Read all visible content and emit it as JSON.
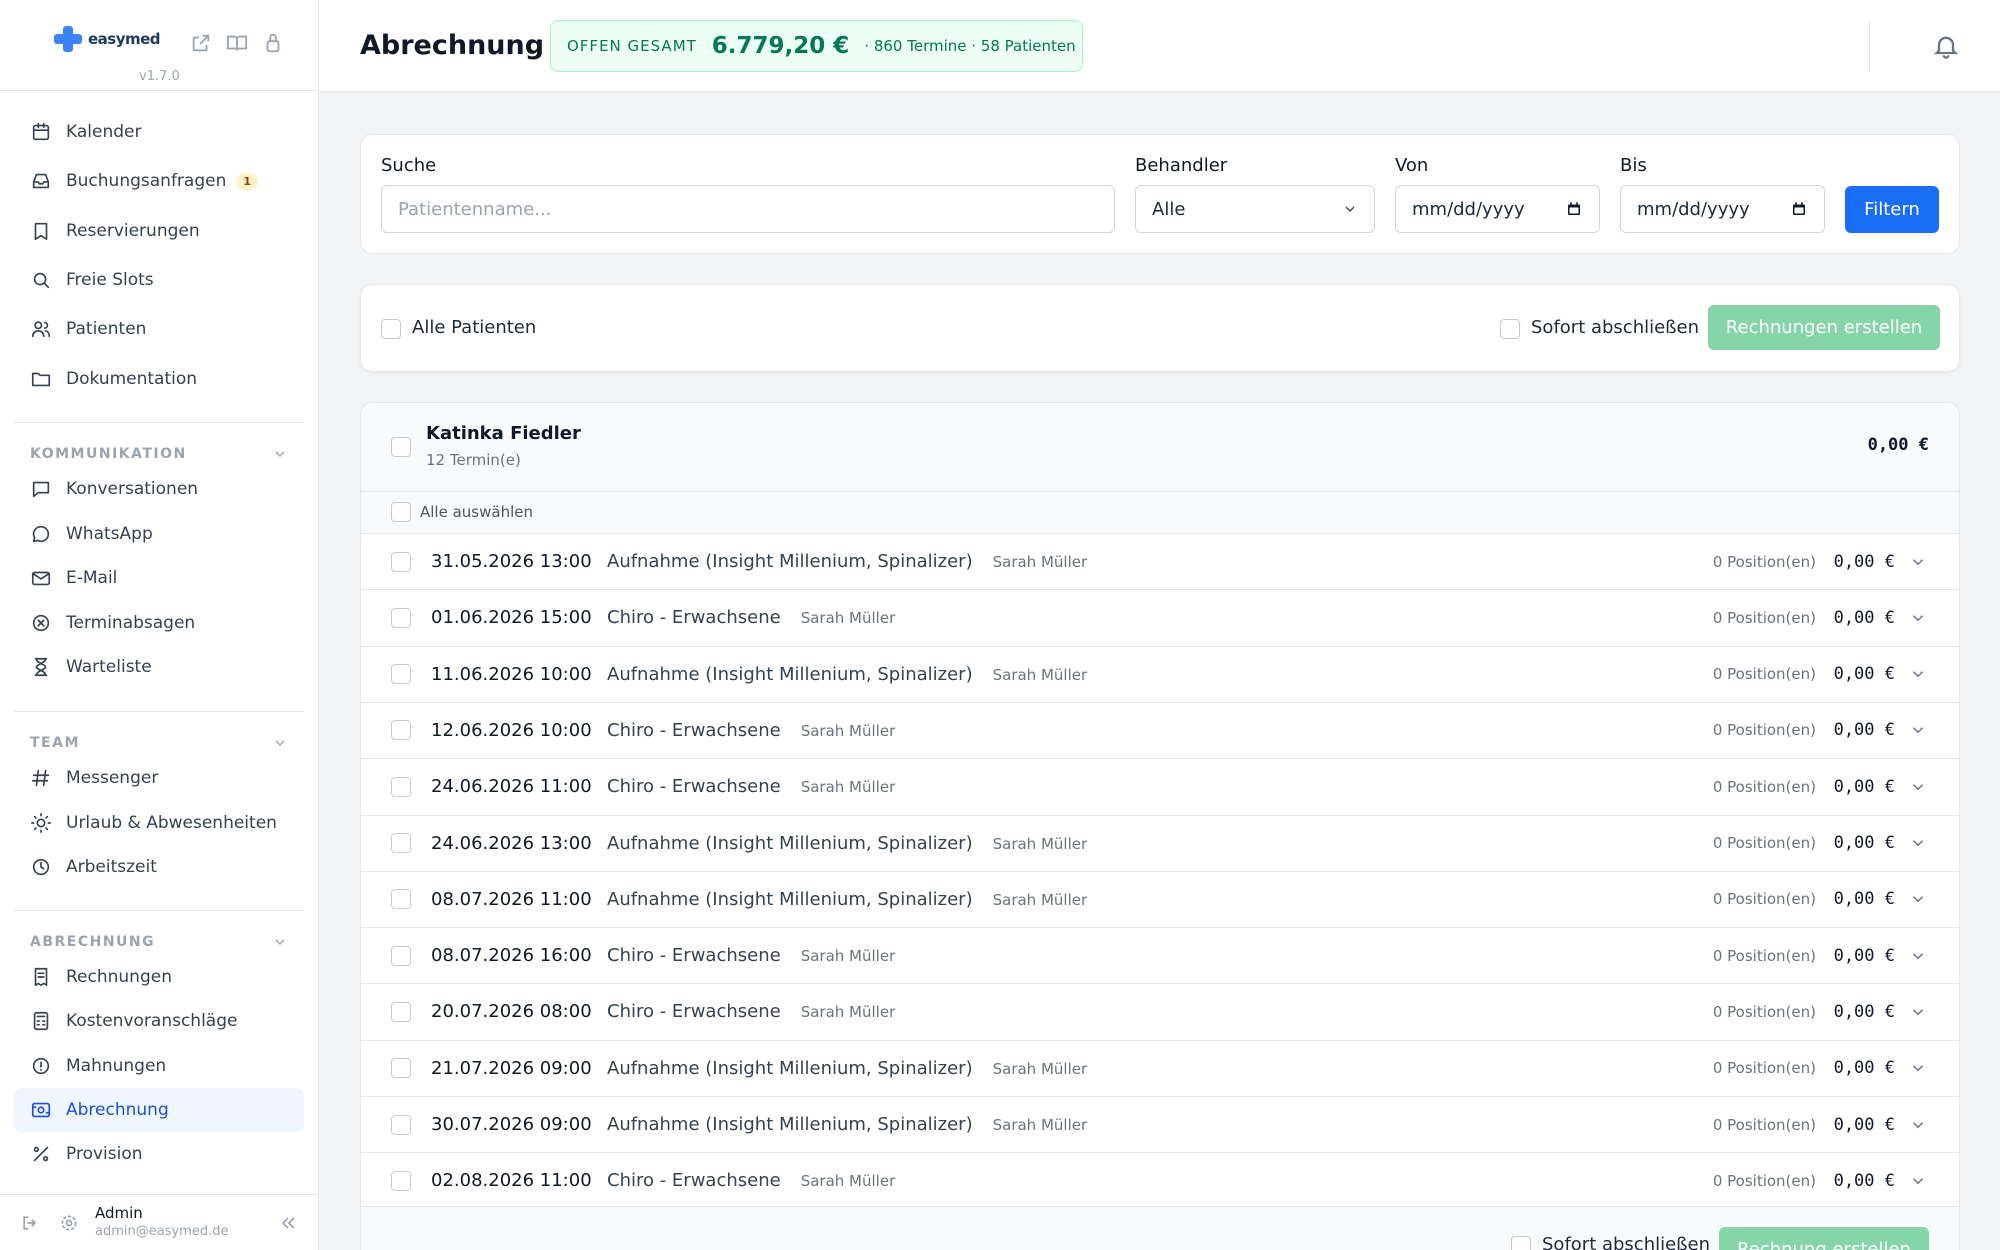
{
  "sidebar": {
    "logo_text": "easymed",
    "version": "v1.7.0",
    "items_top": [
      {
        "label": "Kalender",
        "icon": "calendar-icon"
      },
      {
        "label": "Buchungsanfragen",
        "icon": "inbox-icon",
        "badge": "1"
      },
      {
        "label": "Reservierungen",
        "icon": "bookmark-icon"
      },
      {
        "label": "Freie Slots",
        "icon": "search-icon"
      },
      {
        "label": "Patienten",
        "icon": "users-icon"
      },
      {
        "label": "Dokumentation",
        "icon": "folder-icon"
      }
    ],
    "section_kommunikation": "KOMMUNIKATION",
    "items_kommunikation": [
      {
        "label": "Konversationen",
        "icon": "chat-icon"
      },
      {
        "label": "WhatsApp",
        "icon": "whatsapp-icon"
      },
      {
        "label": "E-Mail",
        "icon": "mail-icon"
      },
      {
        "label": "Terminabsagen",
        "icon": "x-circle-icon"
      },
      {
        "label": "Warteliste",
        "icon": "hourglass-icon"
      }
    ],
    "section_team": "TEAM",
    "items_team": [
      {
        "label": "Messenger",
        "icon": "hash-icon"
      },
      {
        "label": "Urlaub & Abwesenheiten",
        "icon": "sun-icon"
      },
      {
        "label": "Arbeitszeit",
        "icon": "clock-icon"
      }
    ],
    "section_abrechnung": "ABRECHNUNG",
    "items_abrechnung": [
      {
        "label": "Rechnungen",
        "icon": "receipt-icon"
      },
      {
        "label": "Kostenvoranschläge",
        "icon": "calculator-icon"
      },
      {
        "label": "Mahnungen",
        "icon": "alert-circle-icon"
      },
      {
        "label": "Abrechnung",
        "icon": "billing-icon"
      },
      {
        "label": "Provision",
        "icon": "percent-icon"
      }
    ],
    "user_name": "Admin",
    "user_email": "admin@easymed.de"
  },
  "header": {
    "title": "Abrechnung",
    "summary_label": "OFFEN GESAMT",
    "summary_amount": "6.779,20 €",
    "summary_meta": "· 860 Termine · 58 Patienten"
  },
  "filters": {
    "search_label": "Suche",
    "search_placeholder": "Patientenname...",
    "practitioner_label": "Behandler",
    "practitioner_value": "Alle",
    "from_label": "Von",
    "from_value": "mm/dd/yyyy",
    "to_label": "Bis",
    "to_value": "mm/dd/yyyy",
    "filter_button": "Filtern"
  },
  "bulk": {
    "all_patients": "Alle Patienten",
    "close_now": "Sofort abschließen",
    "create_invoices": "Rechnungen erstellen"
  },
  "patient": {
    "name": "Katinka Fiedler",
    "appointments": "12 Termin(e)",
    "total": "0,00 €",
    "select_all": "Alle auswählen",
    "close_now": "Sofort abschließen",
    "create_invoice": "Rechnung erstellen",
    "rows": [
      {
        "date": "31.05.2026 13:00",
        "service": "Aufnahme (Insight Millenium, Spinalizer)",
        "practitioner": "Sarah Müller",
        "positions": "0 Position(en)",
        "amount": "0,00 €"
      },
      {
        "date": "01.06.2026 15:00",
        "service": "Chiro - Erwachsene",
        "practitioner": "Sarah Müller",
        "positions": "0 Position(en)",
        "amount": "0,00 €"
      },
      {
        "date": "11.06.2026 10:00",
        "service": "Aufnahme (Insight Millenium, Spinalizer)",
        "practitioner": "Sarah Müller",
        "positions": "0 Position(en)",
        "amount": "0,00 €"
      },
      {
        "date": "12.06.2026 10:00",
        "service": "Chiro - Erwachsene",
        "practitioner": "Sarah Müller",
        "positions": "0 Position(en)",
        "amount": "0,00 €"
      },
      {
        "date": "24.06.2026 11:00",
        "service": "Chiro - Erwachsene",
        "practitioner": "Sarah Müller",
        "positions": "0 Position(en)",
        "amount": "0,00 €"
      },
      {
        "date": "24.06.2026 13:00",
        "service": "Aufnahme (Insight Millenium, Spinalizer)",
        "practitioner": "Sarah Müller",
        "positions": "0 Position(en)",
        "amount": "0,00 €"
      },
      {
        "date": "08.07.2026 11:00",
        "service": "Aufnahme (Insight Millenium, Spinalizer)",
        "practitioner": "Sarah Müller",
        "positions": "0 Position(en)",
        "amount": "0,00 €"
      },
      {
        "date": "08.07.2026 16:00",
        "service": "Chiro - Erwachsene",
        "practitioner": "Sarah Müller",
        "positions": "0 Position(en)",
        "amount": "0,00 €"
      },
      {
        "date": "20.07.2026 08:00",
        "service": "Chiro - Erwachsene",
        "practitioner": "Sarah Müller",
        "positions": "0 Position(en)",
        "amount": "0,00 €"
      },
      {
        "date": "21.07.2026 09:00",
        "service": "Aufnahme (Insight Millenium, Spinalizer)",
        "practitioner": "Sarah Müller",
        "positions": "0 Position(en)",
        "amount": "0,00 €"
      },
      {
        "date": "30.07.2026 09:00",
        "service": "Aufnahme (Insight Millenium, Spinalizer)",
        "practitioner": "Sarah Müller",
        "positions": "0 Position(en)",
        "amount": "0,00 €"
      },
      {
        "date": "02.08.2026 11:00",
        "service": "Chiro - Erwachsene",
        "practitioner": "Sarah Müller",
        "positions": "0 Position(en)",
        "amount": "0,00 €"
      }
    ]
  },
  "colors": {
    "accent": "#1a6ef5",
    "success_bg": "#ecfdf5",
    "success_text": "#047857",
    "green_button": "#86d5a8"
  }
}
